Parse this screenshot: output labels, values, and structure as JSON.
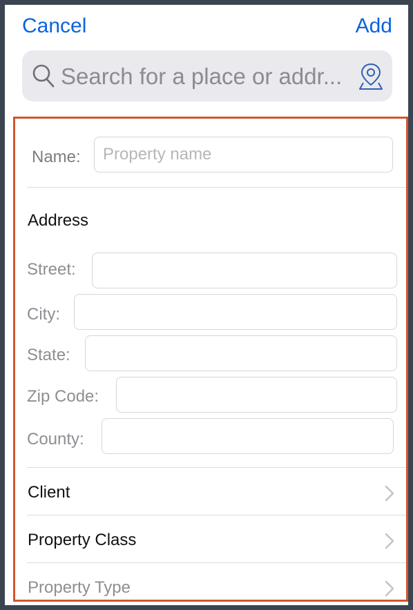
{
  "header": {
    "cancel_label": "Cancel",
    "add_label": "Add"
  },
  "search": {
    "placeholder": "Search for a place or addr...",
    "value": ""
  },
  "form": {
    "name": {
      "label": "Name:",
      "placeholder": "Property name",
      "value": ""
    },
    "address": {
      "title": "Address",
      "street": {
        "label": "Street:",
        "value": ""
      },
      "city": {
        "label": "City:",
        "value": ""
      },
      "state": {
        "label": "State:",
        "value": ""
      },
      "zip": {
        "label": "Zip Code:",
        "value": ""
      },
      "county": {
        "label": "County:",
        "value": ""
      }
    },
    "rows": [
      {
        "label": "Client"
      },
      {
        "label": "Property Class"
      },
      {
        "label": "Property Type"
      }
    ]
  },
  "colors": {
    "accent": "#0a63e0",
    "highlight_border": "#d4542e",
    "muted_text": "#8e8e93"
  },
  "icons": [
    "search-icon",
    "map-pin-icon",
    "chevron-right-icon"
  ]
}
